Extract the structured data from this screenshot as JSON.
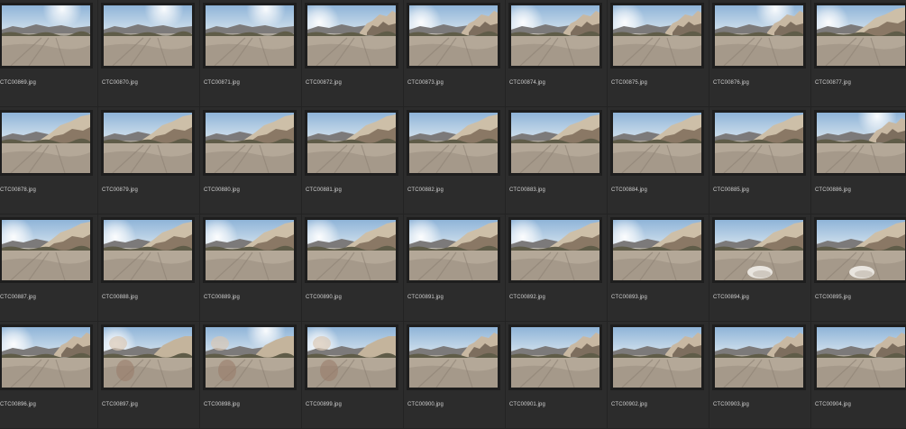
{
  "browser": {
    "thumbnails": [
      {
        "filename": "CTC00869.jpg",
        "variant": "plain",
        "sun": "high"
      },
      {
        "filename": "CTC00870.jpg",
        "variant": "plain",
        "sun": "high"
      },
      {
        "filename": "CTC00871.jpg",
        "variant": "plain",
        "sun": "high"
      },
      {
        "filename": "CTC00872.jpg",
        "variant": "rocks",
        "sun": "left"
      },
      {
        "filename": "CTC00873.jpg",
        "variant": "rocks",
        "sun": "left"
      },
      {
        "filename": "CTC00874.jpg",
        "variant": "rocks",
        "sun": "left"
      },
      {
        "filename": "CTC00875.jpg",
        "variant": "rocks",
        "sun": "left"
      },
      {
        "filename": "CTC00876.jpg",
        "variant": "rocks",
        "sun": "high"
      },
      {
        "filename": "CTC00877.jpg",
        "variant": "cliff",
        "sun": "left"
      },
      {
        "filename": "CTC00878.jpg",
        "variant": "cliff",
        "sun": "none"
      },
      {
        "filename": "CTC00879.jpg",
        "variant": "cliff",
        "sun": "none"
      },
      {
        "filename": "CTC00880.jpg",
        "variant": "cliff",
        "sun": "none"
      },
      {
        "filename": "CTC00881.jpg",
        "variant": "cliff",
        "sun": "none"
      },
      {
        "filename": "CTC00882.jpg",
        "variant": "cliff",
        "sun": "none"
      },
      {
        "filename": "CTC00883.jpg",
        "variant": "cliff",
        "sun": "none"
      },
      {
        "filename": "CTC00884.jpg",
        "variant": "cliff",
        "sun": "none"
      },
      {
        "filename": "CTC00885.jpg",
        "variant": "cliff",
        "sun": "none"
      },
      {
        "filename": "CTC00886.jpg",
        "variant": "rocks",
        "sun": "high"
      },
      {
        "filename": "CTC00887.jpg",
        "variant": "cliff",
        "sun": "left"
      },
      {
        "filename": "CTC00888.jpg",
        "variant": "cliff",
        "sun": "left"
      },
      {
        "filename": "CTC00889.jpg",
        "variant": "cliff",
        "sun": "left"
      },
      {
        "filename": "CTC00890.jpg",
        "variant": "cliff",
        "sun": "left"
      },
      {
        "filename": "CTC00891.jpg",
        "variant": "cliff",
        "sun": "left"
      },
      {
        "filename": "CTC00892.jpg",
        "variant": "cliff",
        "sun": "left"
      },
      {
        "filename": "CTC00893.jpg",
        "variant": "cliff",
        "sun": "left"
      },
      {
        "filename": "CTC00894.jpg",
        "variant": "boulder",
        "sun": "none"
      },
      {
        "filename": "CTC00895.jpg",
        "variant": "boulder",
        "sun": "none"
      },
      {
        "filename": "CTC00896.jpg",
        "variant": "rocks",
        "sun": "left"
      },
      {
        "filename": "CTC00897.jpg",
        "variant": "blur",
        "sun": "left"
      },
      {
        "filename": "CTC00898.jpg",
        "variant": "blur",
        "sun": "high"
      },
      {
        "filename": "CTC00899.jpg",
        "variant": "blur",
        "sun": "left"
      },
      {
        "filename": "CTC00900.jpg",
        "variant": "rocks",
        "sun": "none"
      },
      {
        "filename": "CTC00901.jpg",
        "variant": "rocks",
        "sun": "none"
      },
      {
        "filename": "CTC00902.jpg",
        "variant": "rocks",
        "sun": "none"
      },
      {
        "filename": "CTC00903.jpg",
        "variant": "rocks",
        "sun": "none"
      },
      {
        "filename": "CTC00904.jpg",
        "variant": "rocks",
        "sun": "none"
      }
    ]
  }
}
